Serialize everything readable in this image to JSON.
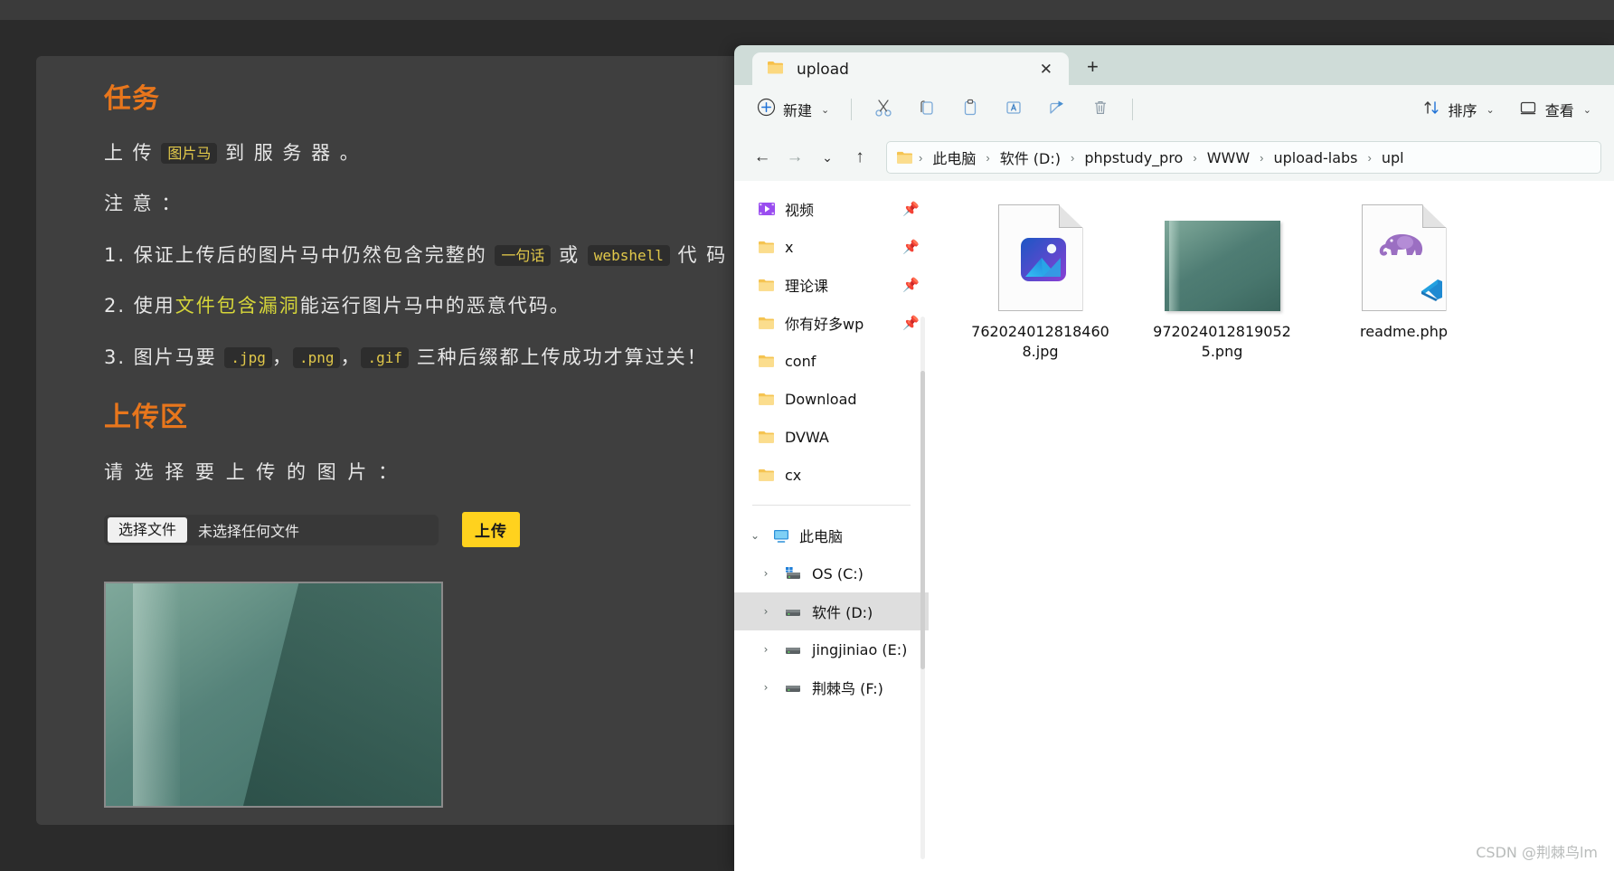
{
  "browser_page": {
    "task_heading": "任务",
    "line_upload_prefix": "上 传",
    "chip_image_horse": "图片马",
    "line_upload_suffix": "到 服 务 器 。",
    "notice_heading": "注 意 ：",
    "note1_prefix": "1. 保证上传后的图片马中仍然包含完整的",
    "note1_chip1": "一句话",
    "note1_or": "或",
    "note1_chip2": "webshell",
    "note1_suffix": "代 码 。",
    "note2_prefix": "2. 使用",
    "note2_kw": "文件包含漏洞",
    "note2_suffix": "能运行图片马中的恶意代码。",
    "note3_prefix": "3. 图片马要",
    "note3_chip1": ".jpg",
    "note3_comma1": "，",
    "note3_chip2": ".png",
    "note3_comma2": "，",
    "note3_chip3": ".gif",
    "note3_suffix": "三种后缀都上传成功才算过关！",
    "upload_zone_heading": "上传区",
    "choose_image_label": "请 选 择 要 上 传 的 图 片 ：",
    "file_choose_button": "选择文件",
    "file_no_selection": "未选择任何文件",
    "upload_button": "上传",
    "accent_orange": "#e8761c",
    "accent_yellow": "#ffd21e"
  },
  "explorer": {
    "tab": {
      "title": "upload",
      "folder_icon": "folder-icon",
      "close_icon": "close-icon",
      "new_tab_icon": "plus-icon"
    },
    "toolbar": {
      "new_label": "新建",
      "cut_icon": "scissors-icon",
      "copy_icon": "copy-icon",
      "paste_icon": "clipboard-icon",
      "rename_icon": "rename-icon",
      "share_icon": "share-icon",
      "delete_icon": "trash-icon",
      "sort_label": "排序",
      "sort_icon": "sort-arrows-icon",
      "view_label": "查看",
      "view_icon": "monitor-icon",
      "chevron": "⌄"
    },
    "navigation": {
      "back_icon": "arrow-left-icon",
      "forward_icon": "arrow-right-icon",
      "recent_icon": "chevron-down-icon",
      "up_icon": "arrow-up-icon"
    },
    "breadcrumb": {
      "folder_icon": "folder-icon",
      "separator": "›",
      "items": [
        {
          "label": "此电脑"
        },
        {
          "label": "软件 (D:)"
        },
        {
          "label": "phpstudy_pro"
        },
        {
          "label": "WWW"
        },
        {
          "label": "upload-labs"
        },
        {
          "label": "upl"
        }
      ]
    },
    "sidebar": {
      "quick_access": [
        {
          "label": "视频",
          "icon": "video-folder-icon",
          "pinned": true
        },
        {
          "label": "x",
          "icon": "folder-icon",
          "pinned": true
        },
        {
          "label": "理论课",
          "icon": "folder-icon",
          "pinned": true
        },
        {
          "label": "你有好多wp",
          "icon": "folder-icon",
          "pinned": true
        },
        {
          "label": "conf",
          "icon": "folder-icon",
          "pinned": false
        },
        {
          "label": "Download",
          "icon": "folder-icon",
          "pinned": false
        },
        {
          "label": "DVWA",
          "icon": "folder-icon",
          "pinned": false
        },
        {
          "label": "cx",
          "icon": "folder-icon",
          "pinned": false
        }
      ],
      "this_pc": {
        "label": "此电脑",
        "icon": "monitor-icon",
        "expanded": true
      },
      "drives": [
        {
          "label": "OS (C:)",
          "icon": "windows-drive-icon",
          "selected": false
        },
        {
          "label": "软件 (D:)",
          "icon": "drive-icon",
          "selected": true
        },
        {
          "label": "jingjiniao (E:)",
          "icon": "drive-icon",
          "selected": false
        },
        {
          "label": "荆棘鸟 (F:)",
          "icon": "drive-icon",
          "selected": false
        }
      ]
    },
    "files": [
      {
        "name": "7620240128184608.jpg",
        "icon": "photos-app-icon",
        "kind": "document"
      },
      {
        "name": "9720240128190525.png",
        "icon": "image-thumbnail",
        "kind": "thumbnail"
      },
      {
        "name": "readme.php",
        "icon": "php-elephant-icon",
        "kind": "document"
      }
    ]
  },
  "watermark": "CSDN @荆棘鸟lm"
}
